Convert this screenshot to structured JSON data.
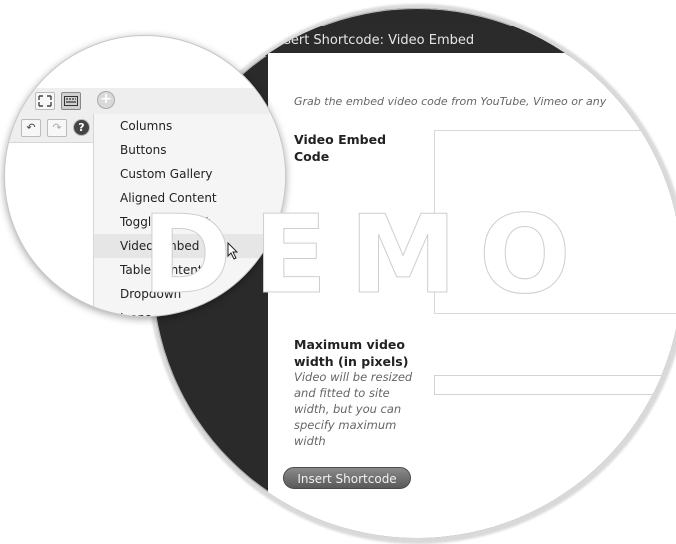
{
  "dialog": {
    "title": "Insert Shortcode: Video Embed",
    "intro": "Grab the embed video code from YouTube, Vimeo or any",
    "embed_label": "Video Embed Code",
    "width_label": "Maximum video width (in pixels)",
    "width_hint": "Video will be resized and fitted to site width, but you can specify maximum width",
    "embed_value": "",
    "width_value": "",
    "insert_button": "Insert Shortcode"
  },
  "menu": {
    "items": [
      {
        "label": "Columns"
      },
      {
        "label": "Buttons"
      },
      {
        "label": "Custom Gallery"
      },
      {
        "label": "Aligned Content"
      },
      {
        "label": "Toggle Content"
      },
      {
        "label": "Video Embed"
      },
      {
        "label": "Table Content"
      },
      {
        "label": "Dropdown"
      },
      {
        "label": "Icons"
      }
    ],
    "hovered_index": 5
  },
  "toolbar": {
    "icons": [
      "fullscreen-icon",
      "kitchen-sink-icon",
      "add-shortcode-icon",
      "undo-icon",
      "redo-icon",
      "help-icon"
    ]
  },
  "watermark": "DEMO",
  "colors": {
    "dialog_title_bg": "#2b2b2b",
    "button_bg": "#6b6b6b",
    "menu_bg": "#f5f5f5"
  }
}
